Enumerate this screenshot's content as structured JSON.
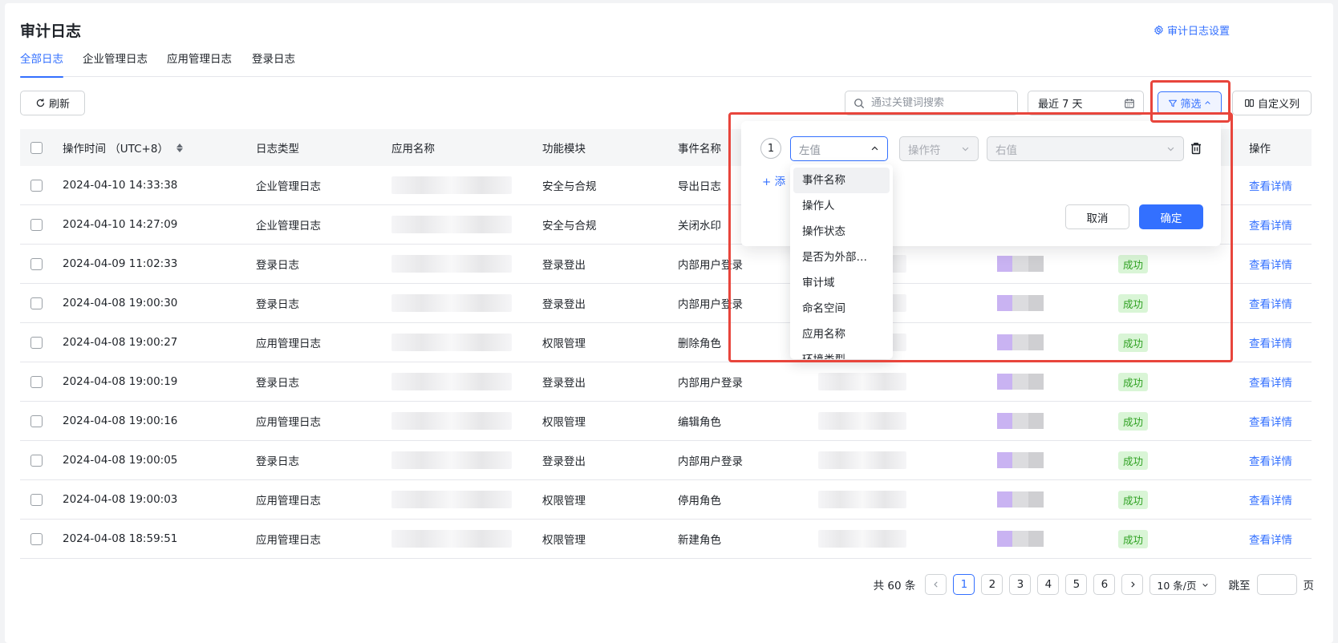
{
  "header": {
    "title": "审计日志",
    "settings_label": "审计日志设置"
  },
  "tabs": [
    {
      "label": "全部日志",
      "active": true
    },
    {
      "label": "企业管理日志",
      "active": false
    },
    {
      "label": "应用管理日志",
      "active": false
    },
    {
      "label": "登录日志",
      "active": false
    }
  ],
  "toolbar": {
    "refresh_label": "刷新",
    "search_placeholder": "通过关键词搜索",
    "date_range": "最近 7 天",
    "filter_label": "筛选",
    "custom_columns_label": "自定义列"
  },
  "table": {
    "columns": [
      "操作时间 （UTC+8）",
      "日志类型",
      "应用名称",
      "功能模块",
      "事件名称",
      "操作"
    ],
    "rows": [
      {
        "time": "2024-04-10 14:33:38",
        "type": "企业管理日志",
        "module": "安全与合规",
        "event": "导出日志",
        "status": "",
        "action": "查看详情"
      },
      {
        "time": "2024-04-10 14:27:09",
        "type": "企业管理日志",
        "module": "安全与合规",
        "event": "关闭水印",
        "status": "",
        "action": "查看详情"
      },
      {
        "time": "2024-04-09 11:02:33",
        "type": "登录日志",
        "module": "登录登出",
        "event": "内部用户登录",
        "status": "成功",
        "action": "查看详情"
      },
      {
        "time": "2024-04-08 19:00:30",
        "type": "登录日志",
        "module": "登录登出",
        "event": "内部用户登录",
        "status": "成功",
        "action": "查看详情"
      },
      {
        "time": "2024-04-08 19:00:27",
        "type": "应用管理日志",
        "module": "权限管理",
        "event": "删除角色",
        "status": "成功",
        "action": "查看详情"
      },
      {
        "time": "2024-04-08 19:00:19",
        "type": "登录日志",
        "module": "登录登出",
        "event": "内部用户登录",
        "status": "成功",
        "action": "查看详情"
      },
      {
        "time": "2024-04-08 19:00:16",
        "type": "应用管理日志",
        "module": "权限管理",
        "event": "编辑角色",
        "status": "成功",
        "action": "查看详情"
      },
      {
        "time": "2024-04-08 19:00:05",
        "type": "登录日志",
        "module": "登录登出",
        "event": "内部用户登录",
        "status": "成功",
        "action": "查看详情"
      },
      {
        "time": "2024-04-08 19:00:03",
        "type": "应用管理日志",
        "module": "权限管理",
        "event": "停用角色",
        "status": "成功",
        "action": "查看详情"
      },
      {
        "time": "2024-04-08 18:59:51",
        "type": "应用管理日志",
        "module": "权限管理",
        "event": "新建角色",
        "status": "成功",
        "action": "查看详情"
      }
    ]
  },
  "pagination": {
    "total": "共 60 条",
    "pages": [
      "1",
      "2",
      "3",
      "4",
      "5",
      "6"
    ],
    "current": "1",
    "page_size": "10 条/页",
    "jump_label": "跳至",
    "page_suffix": "页"
  },
  "filter_panel": {
    "index": "1",
    "left_placeholder": "左值",
    "operator_placeholder": "操作符",
    "right_placeholder": "右值",
    "add_label": "+ 添",
    "cancel_label": "取消",
    "confirm_label": "确定",
    "options": [
      "事件名称",
      "操作人",
      "操作状态",
      "是否为外部…",
      "审计域",
      "命名空间",
      "应用名称",
      "环境类型"
    ]
  },
  "colors": {
    "accent": "#3370ff",
    "highlight": "#e8453c",
    "success_bg": "#d9f5d6",
    "success_text": "#2ea121"
  }
}
